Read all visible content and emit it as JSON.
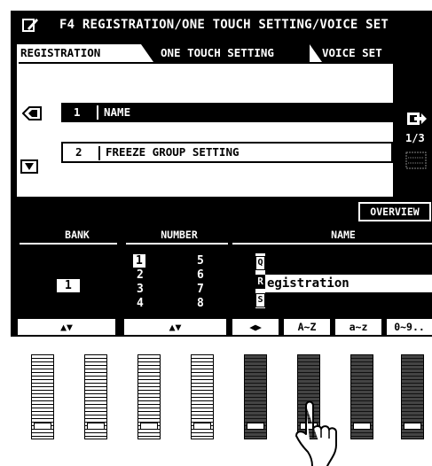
{
  "title": "F4 REGISTRATION/ONE TOUCH SETTING/VOICE SET",
  "tabs": {
    "registration": "REGISTRATION",
    "one_touch": "ONE TOUCH SETTING",
    "voice_set": "VOICE SET"
  },
  "items": [
    {
      "num": "1",
      "label": "NAME"
    },
    {
      "num": "2",
      "label": "FREEZE GROUP SETTING"
    }
  ],
  "page_indicator": "1/3",
  "overview": "OVERVIEW",
  "columns": {
    "bank": "BANK",
    "number": "NUMBER",
    "name": "NAME"
  },
  "bank_value": "1",
  "numbers_col1": [
    "1",
    "2",
    "3",
    "4"
  ],
  "numbers_col2": [
    "5",
    "6",
    "7",
    "8"
  ],
  "name_chars": [
    "Q",
    "R",
    "S"
  ],
  "name_value": "egistration",
  "bottom_buttons": {
    "bank": "▲▼",
    "number": "▲▼",
    "cursor": "◀▶",
    "upper": "A~Z",
    "lower": "a~z",
    "digits": "0~9.."
  }
}
